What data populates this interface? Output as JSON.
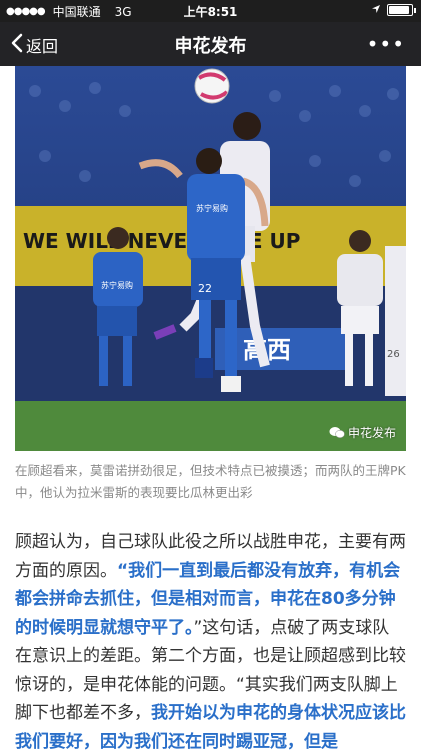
{
  "status_bar": {
    "signal": "●●●●●",
    "carrier": "中国联通",
    "network": "3G",
    "time": "上午8:51",
    "battery_level": 0.9
  },
  "nav": {
    "back_label": "返回",
    "title": "申花发布",
    "more": "•••"
  },
  "photo": {
    "watermark": "申花发布",
    "wall_text": "WE WILL NEVER GIVE UP",
    "banner_text": "高西",
    "player_sponsor": "苏宁易购",
    "player_number": "22",
    "left_player_sponsor": "苏宁易购",
    "right_player_number": "26"
  },
  "caption": "在顾超看来，莫雷诺拼劲很足，但技术特点已被摸透；而两队的王牌PK中，他认为拉米雷斯的表现要比瓜林更出彩",
  "paragraph": {
    "p1": "顾超认为，自己球队此役之所以战胜申花，主要有两方面的原因。",
    "quote1": "“我们一直到最后都没有放弃，有机会都会拼命去抓住，但是相对而言，申花在80多分钟的时候明显就想守平了。",
    "p2": "”这句话，点破了两支球队在意识上的差距。第二个方面，也是让顾超感到比较惊讶的，是申花体能的问题。“其实我们两支队脚上脚下也都差不多，",
    "quote2": "我开始以为申花的身体状况应该比我们要好，因为我们还在同时踢亚冠，但是"
  }
}
